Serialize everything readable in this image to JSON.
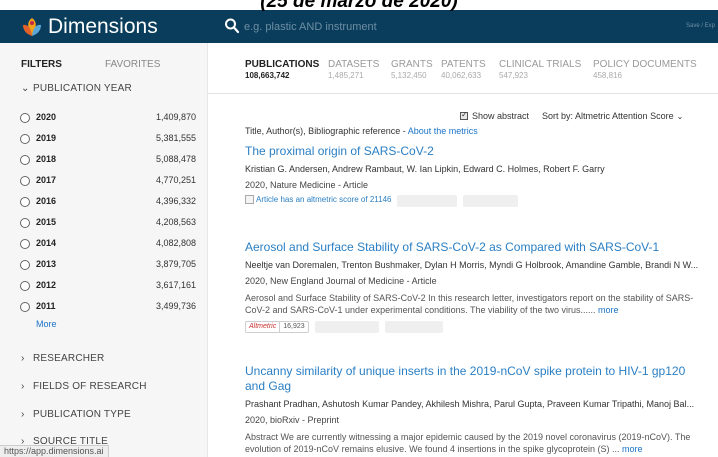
{
  "caption": "(25 de marzo de 2020)",
  "header": {
    "brand": "Dimensions",
    "logo_icon": "dimensions-logo-icon",
    "search_placeholder": "e.g. plastic AND instrument",
    "save_export": "Save / Exp"
  },
  "sidebar": {
    "tabs": [
      {
        "label": "FILTERS",
        "active": true
      },
      {
        "label": "FAVORITES",
        "active": false
      }
    ],
    "publication_year": {
      "heading": "PUBLICATION YEAR",
      "years": [
        {
          "year": "2020",
          "count": "1,409,870"
        },
        {
          "year": "2019",
          "count": "5,381,555"
        },
        {
          "year": "2018",
          "count": "5,088,478"
        },
        {
          "year": "2017",
          "count": "4,770,251"
        },
        {
          "year": "2016",
          "count": "4,396,332"
        },
        {
          "year": "2015",
          "count": "4,208,563"
        },
        {
          "year": "2014",
          "count": "4,082,808"
        },
        {
          "year": "2013",
          "count": "3,879,705"
        },
        {
          "year": "2012",
          "count": "3,617,161"
        },
        {
          "year": "2011",
          "count": "3,499,736"
        }
      ],
      "more": "More"
    },
    "sections": [
      "RESEARCHER",
      "FIELDS OF RESEARCH",
      "PUBLICATION TYPE",
      "SOURCE TITLE"
    ],
    "status_url": "https://app.dimensions.ai"
  },
  "main": {
    "tabs": [
      {
        "label": "PUBLICATIONS",
        "count": "108,663,742",
        "active": true
      },
      {
        "label": "DATASETS",
        "count": "1,485,271",
        "active": false
      },
      {
        "label": "GRANTS",
        "count": "5,132,450",
        "active": false
      },
      {
        "label": "PATENTS",
        "count": "40,062,633",
        "active": false
      },
      {
        "label": "CLINICAL TRIALS",
        "count": "547,923",
        "active": false
      },
      {
        "label": "POLICY DOCUMENTS",
        "count": "458,816",
        "active": false
      }
    ],
    "show_abstract": "Show abstract",
    "show_abstract_checked": true,
    "sort_label": "Sort by:",
    "sort_value": "Altmetric Attention Score",
    "columns_text": "Title, Author(s), Bibliographic reference - ",
    "columns_link": "About the metrics",
    "publications": [
      {
        "title": "The proximal origin of SARS-CoV-2",
        "authors": "Kristian G. Andersen, Andrew Rambaut, W. Ian Lipkin, Edward C. Holmes, Robert F. Garry",
        "meta": "2020, Nature Medicine - Article",
        "altmetric_alt": "Article has an altmetric score of 21146"
      },
      {
        "title": "Aerosol and Surface Stability of SARS-CoV-2 as Compared with SARS-CoV-1",
        "authors": "Neeltje van Doremalen, Trenton Bushmaker, Dylan H Morris, Myndi G Holbrook, Amandine Gamble, Brandi N W...",
        "meta": "2020, New England Journal of Medicine - Article",
        "abstract": "Aerosol and Surface Stability of SARS-CoV-2 In this research letter, investigators report on the stability of SARS-CoV-2 and SARS-CoV-1 under experimental conditions. The viability of the two virus...... ",
        "more": "more",
        "altmetric_name": "Altmetric",
        "altmetric_score": "16,923"
      },
      {
        "title": "Uncanny similarity of unique inserts in the 2019-nCoV spike protein to HIV-1 gp120 and Gag",
        "authors": "Prashant Pradhan, Ashutosh Kumar Pandey, Akhilesh Mishra, Parul Gupta, Praveen Kumar Tripathi, Manoj Bal...",
        "meta": "2020, bioRxiv - Preprint",
        "abstract": "Abstract We are currently witnessing a major epidemic caused by the 2019 novel coronavirus (2019-nCoV). The evolution of 2019-nCoV remains elusive. We found 4 insertions in the spike glycoprotein (S) ... ",
        "more": "more"
      }
    ]
  },
  "colors": {
    "topbar": "#0a3d5c",
    "link": "#2a7fc4",
    "sidebar": "#f6f6f6"
  }
}
